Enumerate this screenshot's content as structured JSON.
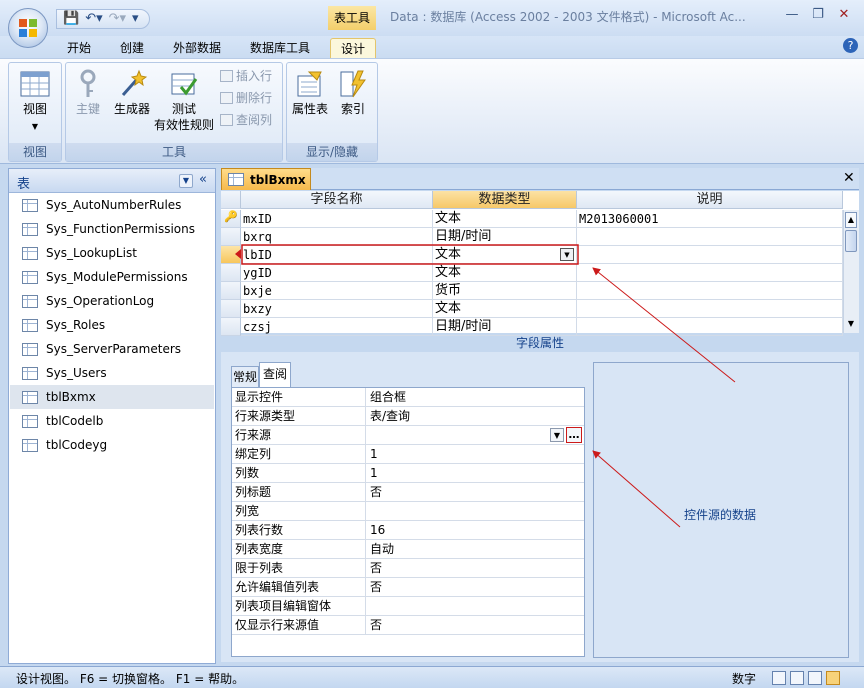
{
  "window": {
    "title": "Data : 数据库 (Access 2002 - 2003 文件格式) - Microsoft Ac...",
    "contextual_tab_group": "表工具"
  },
  "ribbon": {
    "tabs": [
      "开始",
      "创建",
      "外部数据",
      "数据库工具",
      "设计"
    ],
    "active_tab": "设计",
    "groups": {
      "views": {
        "caption": "视图",
        "view_label": "视图"
      },
      "tools": {
        "caption": "工具",
        "primary_key": "主键",
        "builder": "生成器",
        "test_rules_line1": "测试",
        "test_rules_line2": "有效性规则",
        "insert_row": "插入行",
        "delete_row": "删除行",
        "lookup_column": "查阅列"
      },
      "showhide": {
        "caption": "显示/隐藏",
        "property_sheet": "属性表",
        "indexes": "索引"
      }
    }
  },
  "nav": {
    "title": "表",
    "items": [
      "Sys_AutoNumberRules",
      "Sys_FunctionPermissions",
      "Sys_LookupList",
      "Sys_ModulePermissions",
      "Sys_OperationLog",
      "Sys_Roles",
      "Sys_ServerParameters",
      "Sys_Users",
      "tblBxmx",
      "tblCodelb",
      "tblCodeyg"
    ],
    "selected": "tblBxmx"
  },
  "document": {
    "tab_label": "tblBxmx",
    "columns": {
      "field_name": "字段名称",
      "data_type": "数据类型",
      "description": "说明"
    },
    "rows": [
      {
        "field": "mxID",
        "type": "文本",
        "desc": "M2013060001"
      },
      {
        "field": "bxrq",
        "type": "日期/时间",
        "desc": ""
      },
      {
        "field": "lbID",
        "type": "文本",
        "desc": ""
      },
      {
        "field": "ygID",
        "type": "文本",
        "desc": ""
      },
      {
        "field": "bxje",
        "type": "货币",
        "desc": ""
      },
      {
        "field": "bxzy",
        "type": "文本",
        "desc": ""
      },
      {
        "field": "czsj",
        "type": "日期/时间",
        "desc": ""
      }
    ],
    "field_properties_caption": "字段属性",
    "property_tabs": {
      "general": "常规",
      "lookup": "查阅"
    },
    "properties": [
      {
        "k": "显示控件",
        "v": "组合框"
      },
      {
        "k": "行来源类型",
        "v": "表/查询"
      },
      {
        "k": "行来源",
        "v": ""
      },
      {
        "k": "绑定列",
        "v": "1"
      },
      {
        "k": "列数",
        "v": "1"
      },
      {
        "k": "列标题",
        "v": "否"
      },
      {
        "k": "列宽",
        "v": ""
      },
      {
        "k": "列表行数",
        "v": "16"
      },
      {
        "k": "列表宽度",
        "v": "自动"
      },
      {
        "k": "限于列表",
        "v": "否"
      },
      {
        "k": "允许编辑值列表",
        "v": "否"
      },
      {
        "k": "列表项目编辑窗体",
        "v": ""
      },
      {
        "k": "仅显示行来源值",
        "v": "否"
      }
    ],
    "annotation": "控件源的数据"
  },
  "statusbar": {
    "left": "设计视图。 F6 = 切换窗格。 F1 = 帮助。",
    "mode": "数字"
  },
  "colors": {
    "annotation_red": "#cc1a1a",
    "accent_orange": "#f6b94b"
  }
}
